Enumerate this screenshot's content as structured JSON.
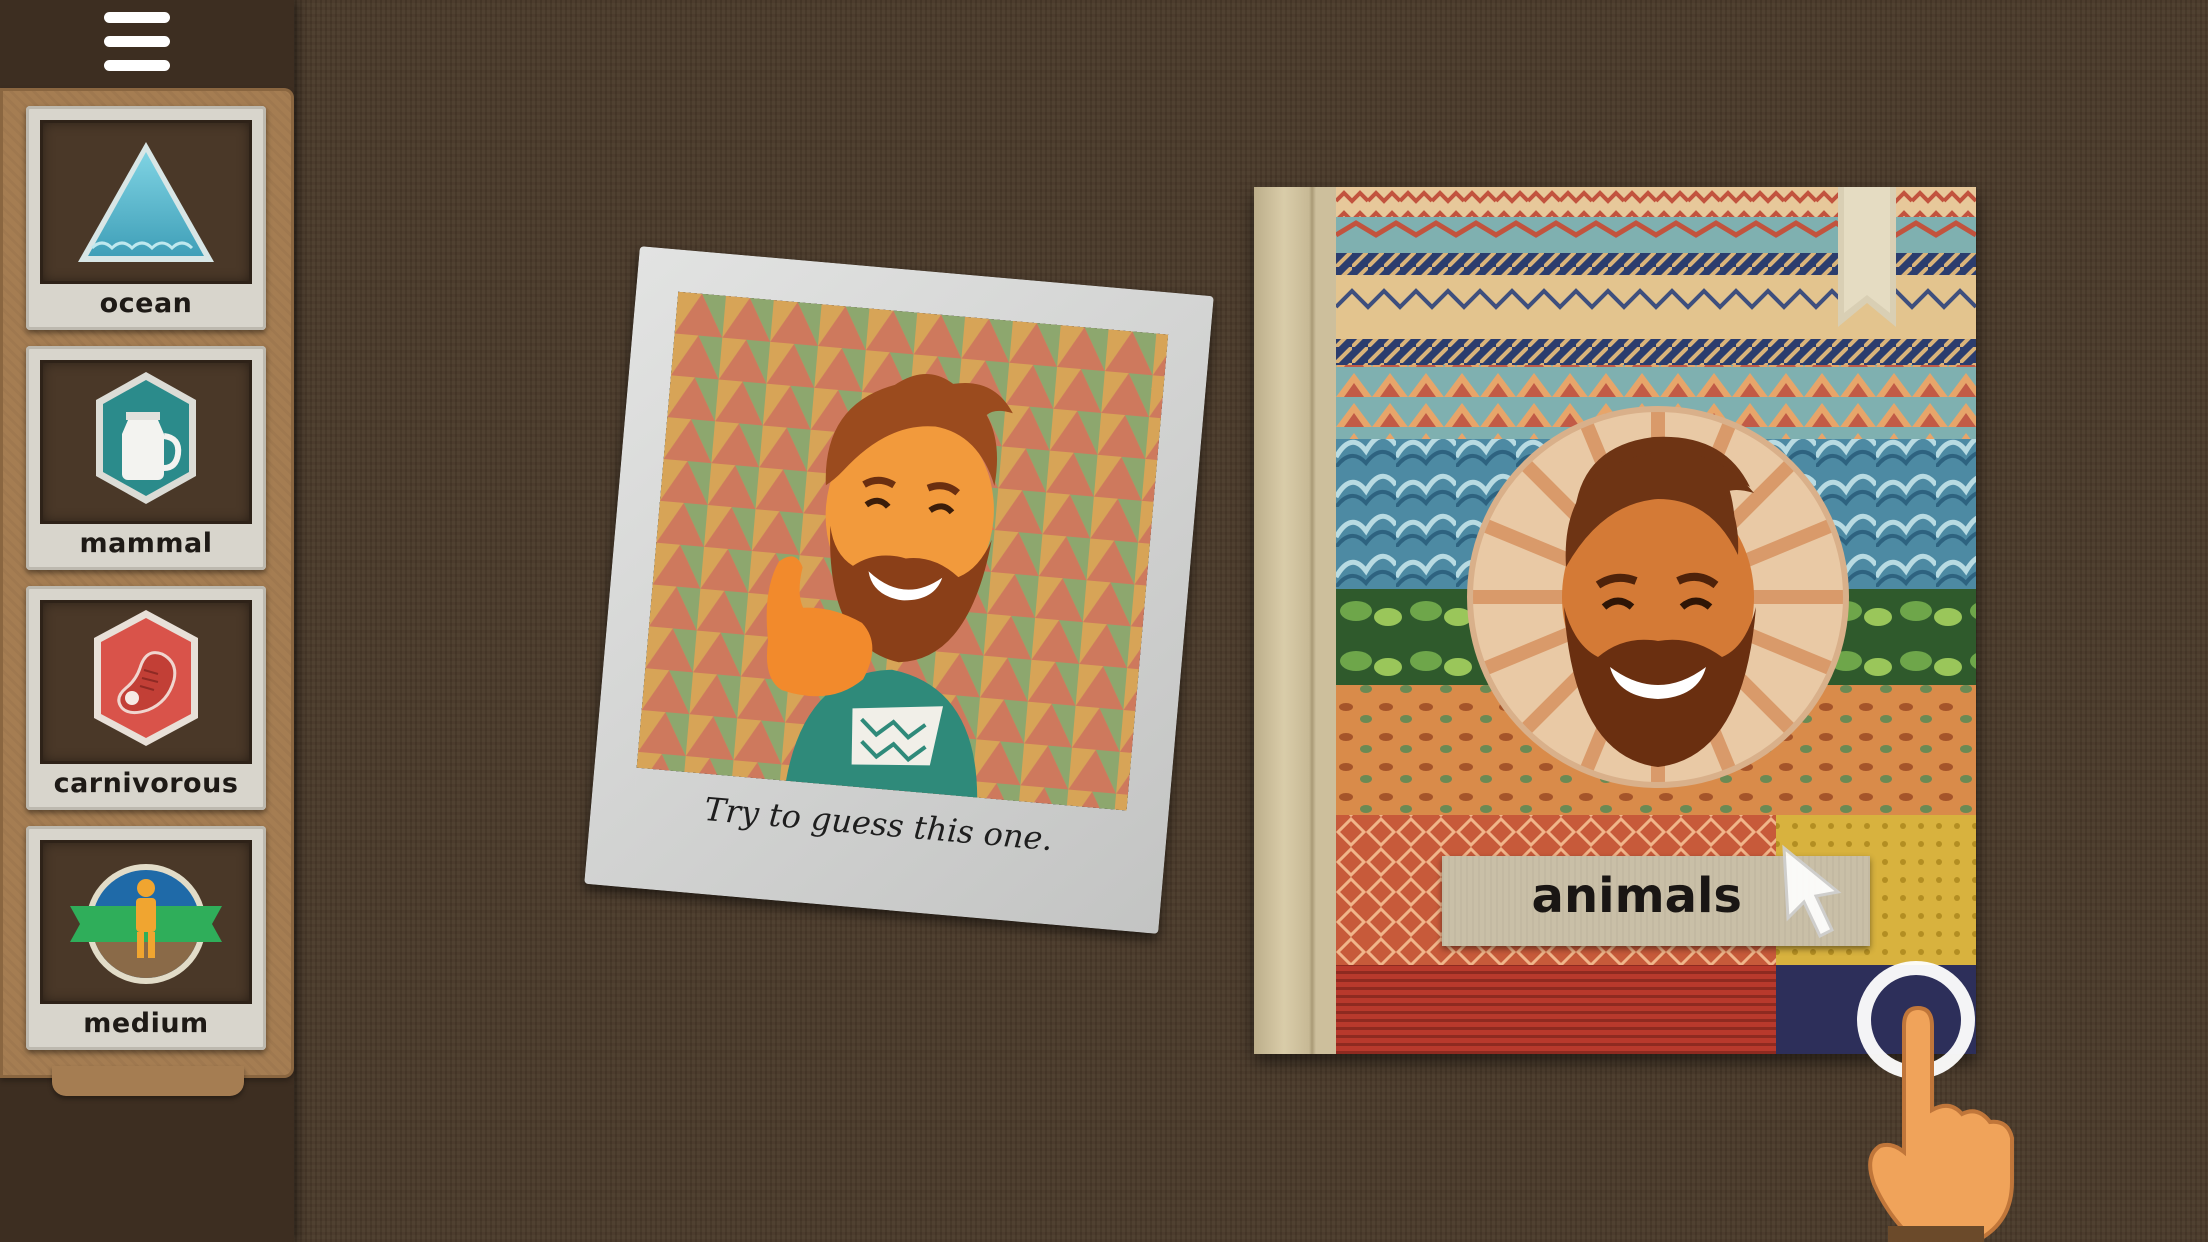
{
  "sidebar": {
    "menu_icon": "hamburger-menu-icon",
    "cards": [
      {
        "label": "ocean",
        "icon": "ocean-triangle-icon"
      },
      {
        "label": "mammal",
        "icon": "milk-jug-icon"
      },
      {
        "label": "carnivorous",
        "icon": "meat-steak-icon"
      },
      {
        "label": "medium",
        "icon": "medium-size-person-icon"
      }
    ]
  },
  "polaroid": {
    "caption": "Try to guess this one."
  },
  "book": {
    "title": "animals"
  },
  "colors": {
    "background": "#4a3a2a",
    "tray": "#a57d52",
    "card": "#d8d5cc",
    "accent_teal": "#2f8f8f",
    "accent_red": "#d9534a"
  }
}
